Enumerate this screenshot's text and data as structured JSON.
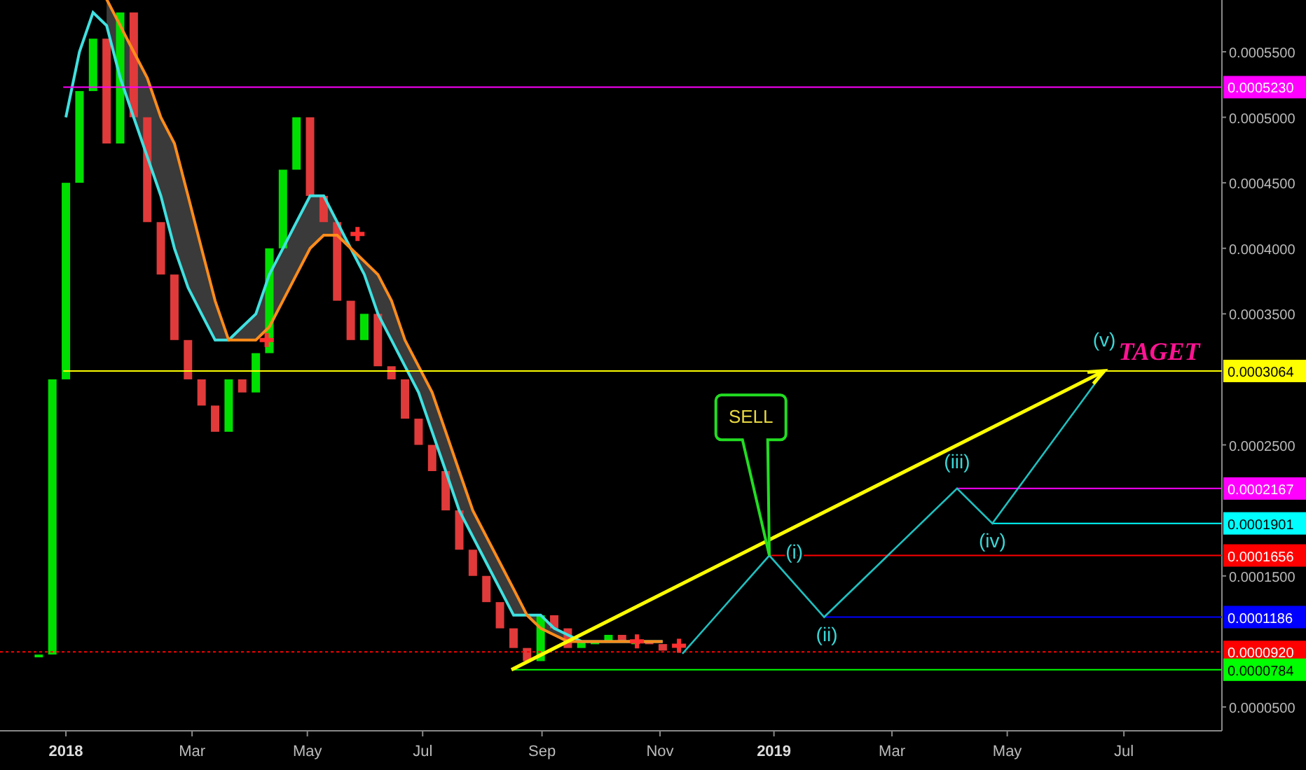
{
  "chart": {
    "y_axis": {
      "ticks": [
        "0.0005500",
        "0.0005000",
        "0.0004500",
        "0.0004000",
        "0.0003500",
        "0.0002500",
        "0.0001500",
        "0.0000500"
      ]
    },
    "x_axis": {
      "ticks": [
        {
          "label": "2018",
          "kind": "year"
        },
        {
          "label": "Mar",
          "kind": "month"
        },
        {
          "label": "May",
          "kind": "month"
        },
        {
          "label": "Jul",
          "kind": "month"
        },
        {
          "label": "Sep",
          "kind": "month"
        },
        {
          "label": "Nov",
          "kind": "month"
        },
        {
          "label": "2019",
          "kind": "year"
        },
        {
          "label": "Mar",
          "kind": "month"
        },
        {
          "label": "May",
          "kind": "month"
        },
        {
          "label": "Jul",
          "kind": "month"
        }
      ]
    },
    "price_levels": [
      {
        "label": "0.0005230",
        "color": "#ff00ff",
        "kind": "solid"
      },
      {
        "label": "0.0003064",
        "color": "#ffff00",
        "kind": "solid"
      },
      {
        "label": "0.0002167",
        "color": "#ff00ff",
        "kind": "solid"
      },
      {
        "label": "0.0001901",
        "color": "#00ffff",
        "kind": "solid"
      },
      {
        "label": "0.0001656",
        "color": "#ff0000",
        "kind": "solid"
      },
      {
        "label": "0.0001186",
        "color": "#0000ff",
        "kind": "solid"
      },
      {
        "label": "0.0000920",
        "color": "#ff0000",
        "kind": "dotted"
      },
      {
        "label": "0.0000784",
        "color": "#00ff00",
        "kind": "solid"
      }
    ],
    "wave_labels": [
      "(i)",
      "(ii)",
      "(iii)",
      "(iv)",
      "(v)"
    ],
    "callout": "SELL",
    "target_label": "TAGET"
  }
}
